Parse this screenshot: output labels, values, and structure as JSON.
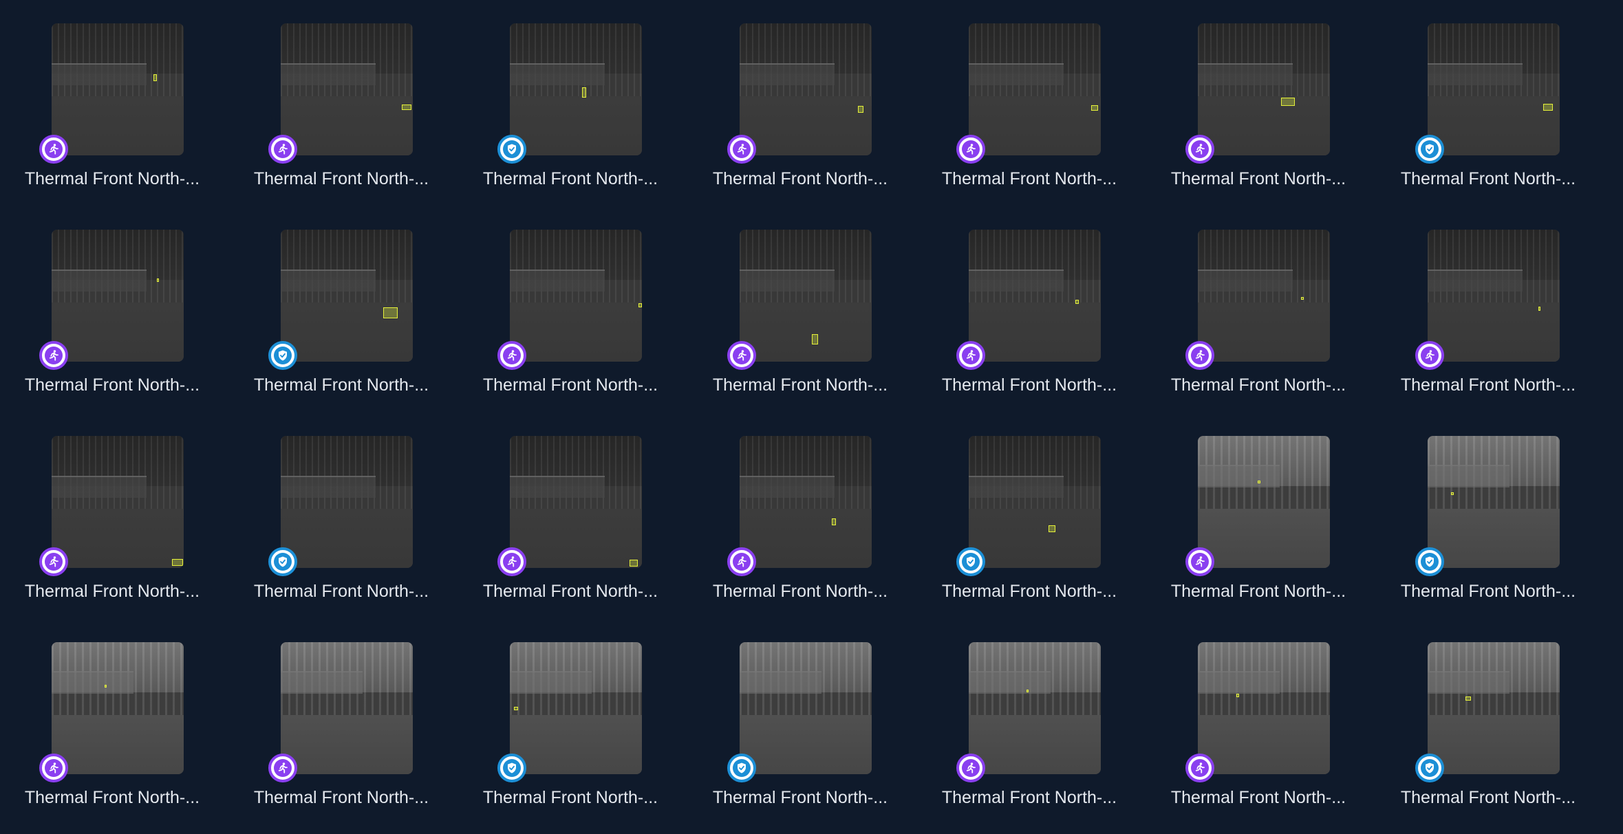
{
  "gallery": {
    "columns": 7,
    "rows": 4,
    "accent_colors": {
      "motion": "#8a3ff0",
      "verified": "#1c8fd6",
      "detection_box": "#e6f23a",
      "background": "#0f1a2b"
    },
    "items": [
      {
        "label": "Thermal Front North-...",
        "badge": "motion",
        "badge_icon": "running-person-icon",
        "scene": "dark"
      },
      {
        "label": "Thermal Front North-...",
        "badge": "motion",
        "badge_icon": "running-person-icon",
        "scene": "dark"
      },
      {
        "label": "Thermal Front North-...",
        "badge": "verified",
        "badge_icon": "shield-check-icon",
        "scene": "dark"
      },
      {
        "label": "Thermal Front North-...",
        "badge": "motion",
        "badge_icon": "running-person-icon",
        "scene": "dark"
      },
      {
        "label": "Thermal Front North-...",
        "badge": "motion",
        "badge_icon": "running-person-icon",
        "scene": "dark"
      },
      {
        "label": "Thermal Front North-...",
        "badge": "motion",
        "badge_icon": "running-person-icon",
        "scene": "dark"
      },
      {
        "label": "Thermal Front North-...",
        "badge": "verified",
        "badge_icon": "shield-check-icon",
        "scene": "dark"
      },
      {
        "label": "Thermal Front North-...",
        "badge": "motion",
        "badge_icon": "running-person-icon",
        "scene": "dark"
      },
      {
        "label": "Thermal Front North-...",
        "badge": "verified",
        "badge_icon": "shield-check-icon",
        "scene": "dark"
      },
      {
        "label": "Thermal Front North-...",
        "badge": "motion",
        "badge_icon": "running-person-icon",
        "scene": "dark"
      },
      {
        "label": "Thermal Front North-...",
        "badge": "motion",
        "badge_icon": "running-person-icon",
        "scene": "dark"
      },
      {
        "label": "Thermal Front North-...",
        "badge": "motion",
        "badge_icon": "running-person-icon",
        "scene": "dark"
      },
      {
        "label": "Thermal Front North-...",
        "badge": "motion",
        "badge_icon": "running-person-icon",
        "scene": "dark"
      },
      {
        "label": "Thermal Front North-...",
        "badge": "motion",
        "badge_icon": "running-person-icon",
        "scene": "dark"
      },
      {
        "label": "Thermal Front North-...",
        "badge": "motion",
        "badge_icon": "running-person-icon",
        "scene": "dark"
      },
      {
        "label": "Thermal Front North-...",
        "badge": "verified",
        "badge_icon": "shield-check-icon",
        "scene": "dark"
      },
      {
        "label": "Thermal Front North-...",
        "badge": "motion",
        "badge_icon": "running-person-icon",
        "scene": "dark"
      },
      {
        "label": "Thermal Front North-...",
        "badge": "motion",
        "badge_icon": "running-person-icon",
        "scene": "dark"
      },
      {
        "label": "Thermal Front North-...",
        "badge": "verified",
        "badge_icon": "shield-check-icon",
        "scene": "dark"
      },
      {
        "label": "Thermal Front North-...",
        "badge": "motion",
        "badge_icon": "running-person-icon",
        "scene": "light"
      },
      {
        "label": "Thermal Front North-...",
        "badge": "verified",
        "badge_icon": "shield-check-icon",
        "scene": "light"
      },
      {
        "label": "Thermal Front North-...",
        "badge": "motion",
        "badge_icon": "running-person-icon",
        "scene": "light"
      },
      {
        "label": "Thermal Front North-...",
        "badge": "motion",
        "badge_icon": "running-person-icon",
        "scene": "light"
      },
      {
        "label": "Thermal Front North-...",
        "badge": "verified",
        "badge_icon": "shield-check-icon",
        "scene": "light"
      },
      {
        "label": "Thermal Front North-...",
        "badge": "verified",
        "badge_icon": "shield-check-icon",
        "scene": "light"
      },
      {
        "label": "Thermal Front North-...",
        "badge": "motion",
        "badge_icon": "running-person-icon",
        "scene": "light"
      },
      {
        "label": "Thermal Front North-...",
        "badge": "motion",
        "badge_icon": "running-person-icon",
        "scene": "light"
      },
      {
        "label": "Thermal Front North-...",
        "badge": "verified",
        "badge_icon": "shield-check-icon",
        "scene": "light"
      }
    ]
  }
}
